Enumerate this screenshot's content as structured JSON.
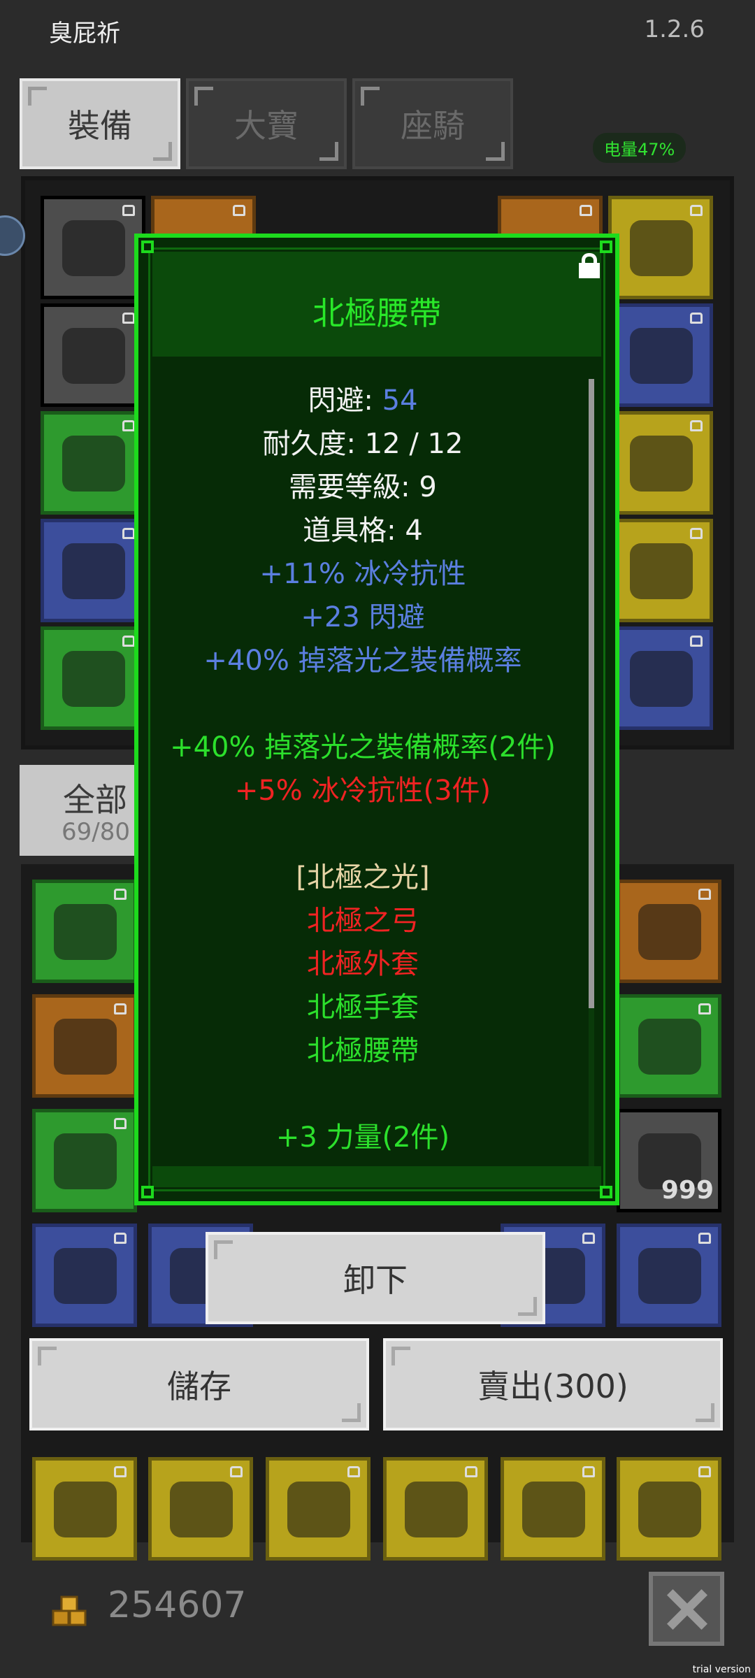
{
  "app": {
    "title": "臭屁祈",
    "version": "1.2.6"
  },
  "tabs": [
    {
      "label": "裝備",
      "active": true
    },
    {
      "label": "大寶",
      "active": false
    },
    {
      "label": "座騎",
      "active": false
    }
  ],
  "status": {
    "battery": "电量47%"
  },
  "inventory": {
    "filter_label": "全部",
    "count": "69/80"
  },
  "item_popup": {
    "title": "北極腰帶",
    "stats": [
      {
        "label": "閃避: ",
        "value": "54"
      },
      {
        "text": "耐久度: 12 / 12"
      },
      {
        "text": "需要等級: 9"
      },
      {
        "text": "道具格: 4"
      }
    ],
    "mods": [
      "+11% 冰冷抗性",
      "+23 閃避",
      "+40% 掉落光之裝備概率"
    ],
    "set_bonuses_active": "+40% 掉落光之裝備概率(2件)",
    "set_bonuses_inactive": "+5% 冰冷抗性(3件)",
    "set_name": "[北極之光]",
    "set_items": [
      {
        "name": "北極之弓",
        "owned": false
      },
      {
        "name": "北極外套",
        "owned": false
      },
      {
        "name": "北極手套",
        "owned": true
      },
      {
        "name": "北極腰帶",
        "owned": true
      }
    ],
    "extra_bonus": "+3 力量(2件)"
  },
  "actions": {
    "unequip": "卸下",
    "store": "儲存",
    "sell": "賣出(300)"
  },
  "wallet": {
    "gold": "254607",
    "stack_count": "999"
  },
  "footer": {
    "trial": "trial version"
  },
  "colors": {
    "popup_border": "#1ddb1d",
    "set_owned": "#2ce02c",
    "set_missing": "#f02323",
    "magic_mod": "#5b7fe0"
  }
}
